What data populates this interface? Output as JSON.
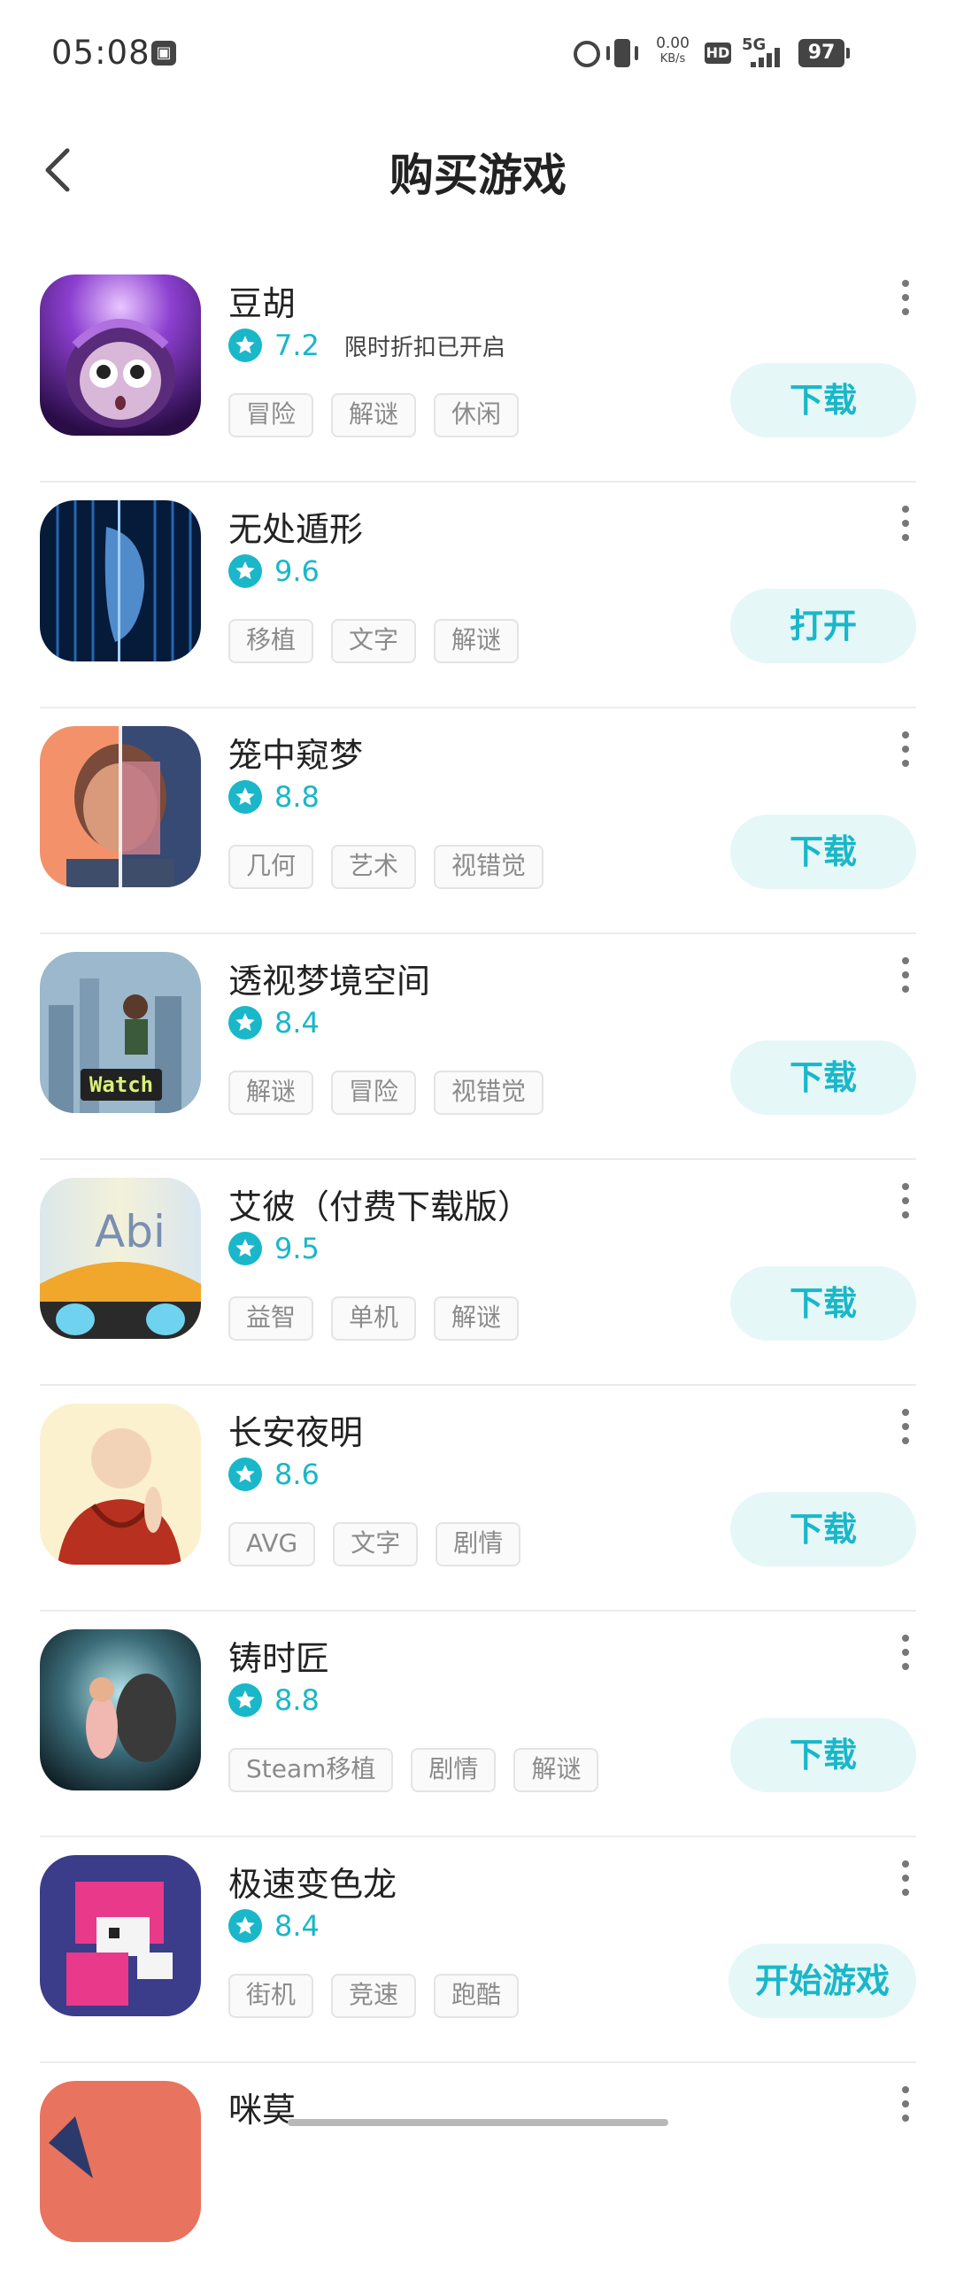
{
  "status_bar": {
    "time": "05:08",
    "net_speed_value": "0.00",
    "net_speed_unit": "KB/s",
    "hd_label": "HD",
    "network_label": "5G",
    "battery": "97"
  },
  "header": {
    "title": "购买游戏"
  },
  "games": [
    {
      "name": "豆胡",
      "score": "7.2",
      "promo": "限时折扣已开启",
      "tags": [
        "冒险",
        "解谜",
        "休闲"
      ],
      "action": "下载"
    },
    {
      "name": "无处遁形",
      "score": "9.6",
      "promo": "",
      "tags": [
        "移植",
        "文字",
        "解谜"
      ],
      "action": "打开"
    },
    {
      "name": "笼中窥梦",
      "score": "8.8",
      "promo": "",
      "tags": [
        "几何",
        "艺术",
        "视错觉"
      ],
      "action": "下载"
    },
    {
      "name": "透视梦境空间",
      "score": "8.4",
      "promo": "",
      "tags": [
        "解谜",
        "冒险",
        "视错觉"
      ],
      "action": "下载",
      "icon_text": "Watch"
    },
    {
      "name": "艾彼（付费下载版）",
      "score": "9.5",
      "promo": "",
      "tags": [
        "益智",
        "单机",
        "解谜"
      ],
      "action": "下载",
      "icon_text": "Abi"
    },
    {
      "name": "长安夜明",
      "score": "8.6",
      "promo": "",
      "tags": [
        "AVG",
        "文字",
        "剧情"
      ],
      "action": "下载"
    },
    {
      "name": "铸时匠",
      "score": "8.8",
      "promo": "",
      "tags": [
        "Steam移植",
        "剧情",
        "解谜"
      ],
      "action": "下载"
    },
    {
      "name": "极速变色龙",
      "score": "8.4",
      "promo": "",
      "tags": [
        "街机",
        "竞速",
        "跑酷"
      ],
      "action": "开始游戏"
    },
    {
      "name": "咪莫",
      "score": "",
      "promo": "",
      "tags": [],
      "action": ""
    }
  ],
  "colors": {
    "accent": "#19b7c9",
    "button_bg": "#e6f7f8"
  }
}
